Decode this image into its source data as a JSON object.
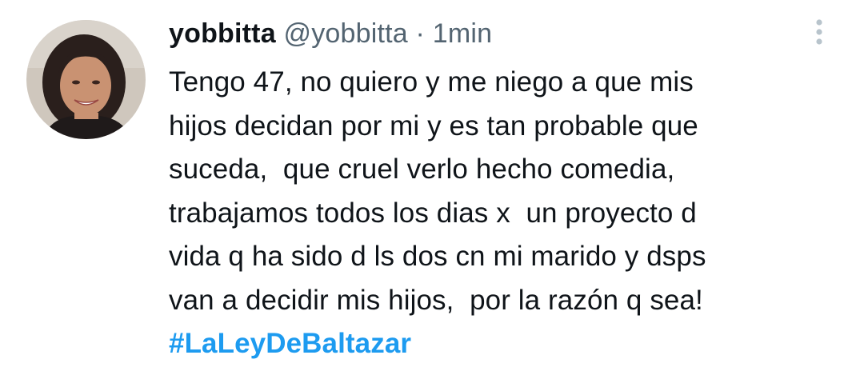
{
  "tweet": {
    "display_name": "yobbitta",
    "handle": "@yobbitta",
    "separator": "·",
    "time": "1min",
    "lines": [
      "Tengo 47, no quiero y me niego a que mis",
      "hijos decidan por mi y es tan probable que",
      "suceda,  que cruel verlo hecho comedia,",
      "trabajamos todos los dias x  un proyecto d",
      "vida q ha sido d ls dos cn mi marido y dsps",
      "van a decidir mis hijos,  por la razón q sea!"
    ],
    "hashtag": "#LaLeyDeBaltazar"
  },
  "icons": {
    "more": "vertical-dots-icon"
  },
  "colors": {
    "text": "#0f1419",
    "secondary": "#536471",
    "link": "#1d9bf0",
    "more_icon": "#b8c4cc"
  }
}
